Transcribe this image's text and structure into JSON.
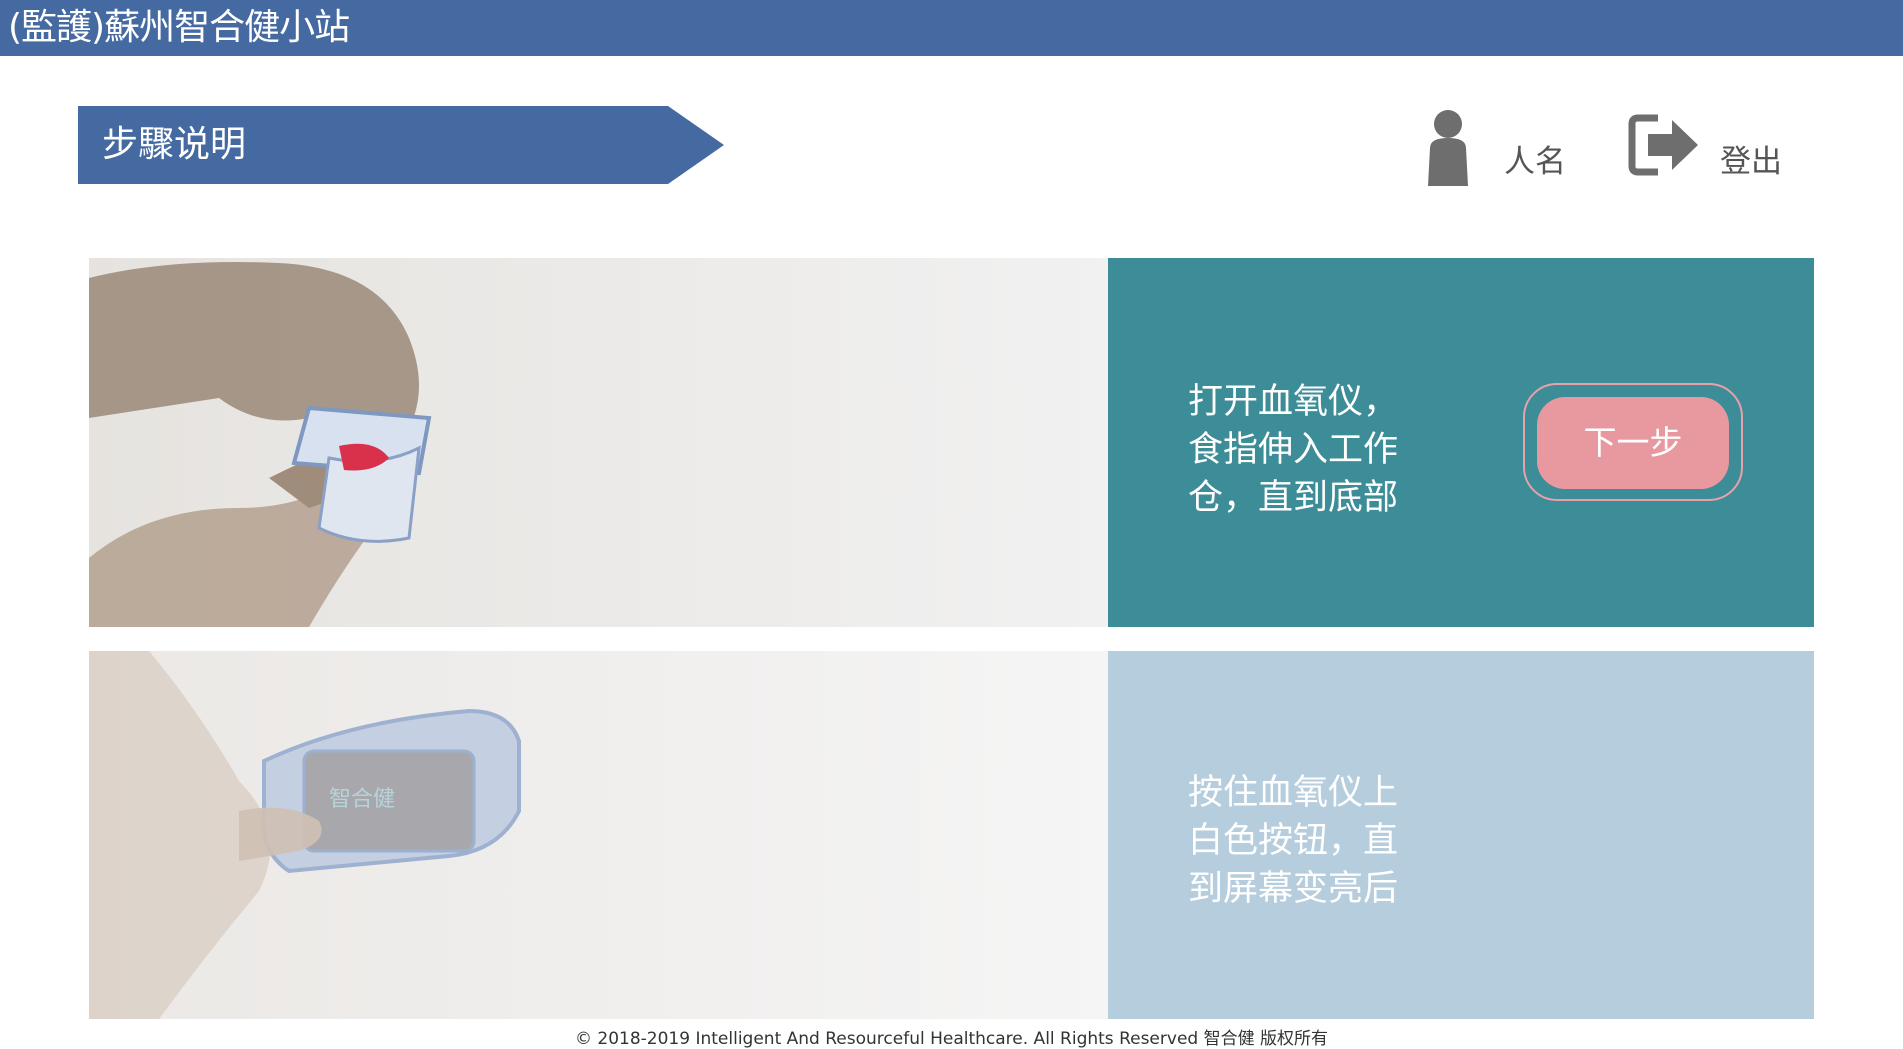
{
  "header": {
    "app_title": "(監護)蘇州智合健小站",
    "background_color": "#4569a1"
  },
  "banner": {
    "title": "步驟说明"
  },
  "user": {
    "name": "人名",
    "icon": "person-icon"
  },
  "logout": {
    "label": "登出",
    "icon": "logout-icon"
  },
  "steps": [
    {
      "instruction": "打开血氧仪，\n食指伸入工作\n仓，直到底部",
      "panel_color": "#3c8d98",
      "image": "finger-in-oximeter-illustration",
      "button_label": "下一步"
    },
    {
      "instruction": "按住血氧仪上\n白色按钮，直\n到屏幕变亮后",
      "panel_color": "#b5cddd",
      "image": "oximeter-screen-illustration",
      "device_screen_text": "智合健"
    }
  ],
  "accent": {
    "button_color": "#e8989f"
  },
  "footer": {
    "text": "© 2018-2019 Intelligent And Resourceful Healthcare. All Rights Reserved 智合健 版权所有"
  }
}
